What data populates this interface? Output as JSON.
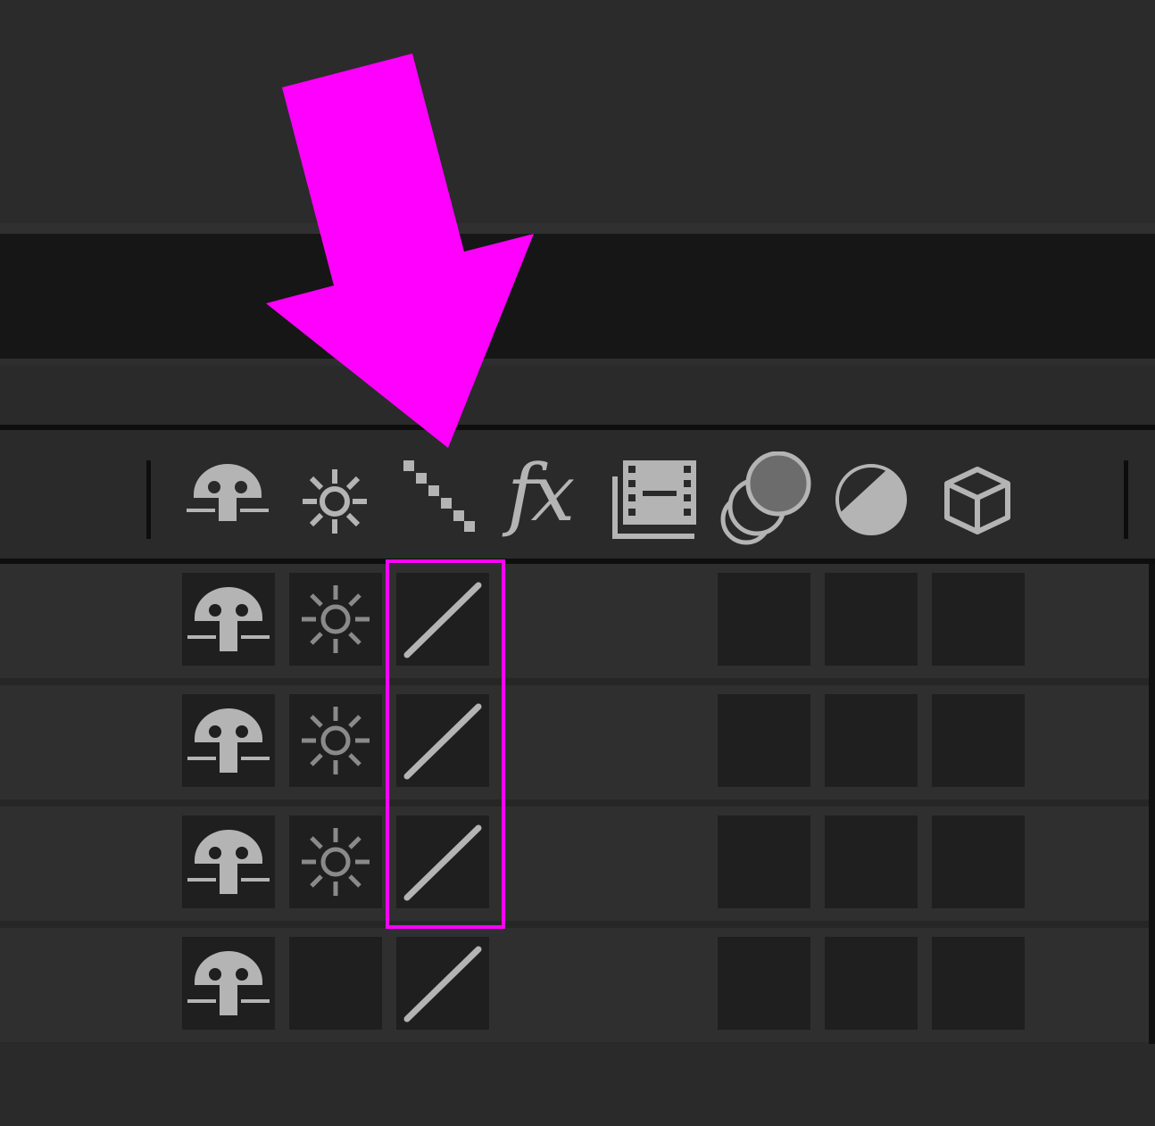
{
  "header": {
    "columns": [
      {
        "icon": "shy-icon"
      },
      {
        "icon": "collapse-transformations-icon"
      },
      {
        "icon": "quality-icon"
      },
      {
        "label": "fx",
        "icon": "effects-icon"
      },
      {
        "icon": "frame-blending-icon"
      },
      {
        "icon": "motion-blur-icon"
      },
      {
        "icon": "adjustment-layer-icon"
      },
      {
        "icon": "3d-layer-icon"
      }
    ]
  },
  "layers": [
    {
      "shy": true,
      "collapse": true,
      "quality": "best"
    },
    {
      "shy": true,
      "collapse": true,
      "quality": "best"
    },
    {
      "shy": true,
      "collapse": true,
      "quality": "best"
    },
    {
      "shy": true,
      "collapse": false,
      "quality": "best"
    }
  ],
  "annotation": {
    "arrow_color": "#ff00ff",
    "highlight_color": "#ff00ff",
    "highlighted_column": "quality-icon"
  },
  "colors": {
    "icon": "#b4b4b4",
    "icon_dim": "#8a8a8a",
    "cell_bg": "#1f1f1f",
    "panel_bg": "#2f2f2f"
  }
}
